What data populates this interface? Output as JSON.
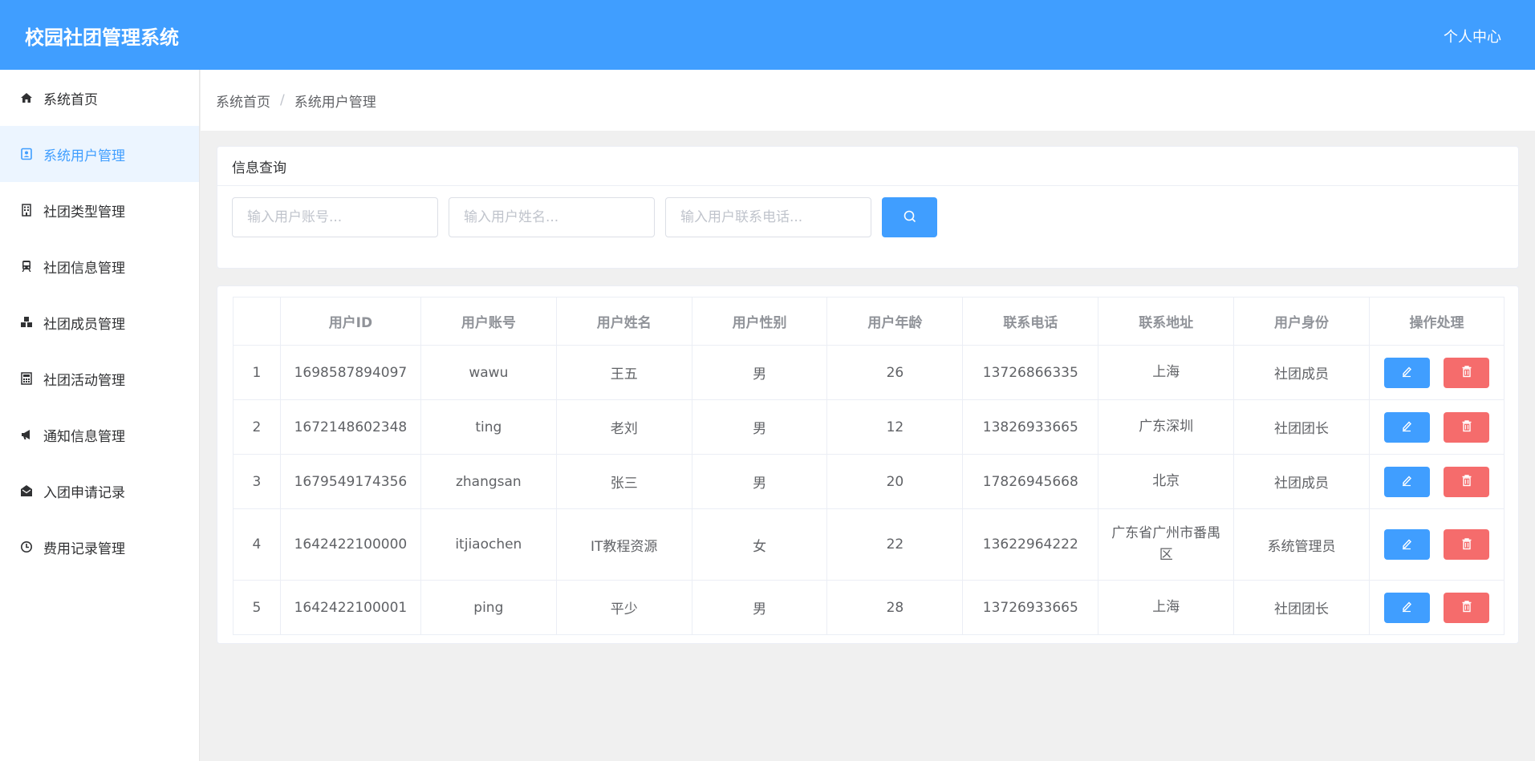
{
  "header": {
    "title": "校园社团管理系统",
    "user_center": "个人中心"
  },
  "sidebar": {
    "items": [
      {
        "label": "系统首页",
        "icon": "home-icon",
        "active": false
      },
      {
        "label": "系统用户管理",
        "icon": "user-card-icon",
        "active": true
      },
      {
        "label": "社团类型管理",
        "icon": "building-icon",
        "active": false
      },
      {
        "label": "社团信息管理",
        "icon": "train-icon",
        "active": false
      },
      {
        "label": "社团成员管理",
        "icon": "cubes-icon",
        "active": false
      },
      {
        "label": "社团活动管理",
        "icon": "calculator-icon",
        "active": false
      },
      {
        "label": "通知信息管理",
        "icon": "megaphone-icon",
        "active": false
      },
      {
        "label": "入团申请记录",
        "icon": "envelope-open-icon",
        "active": false
      },
      {
        "label": "费用记录管理",
        "icon": "clock-icon",
        "active": false
      }
    ]
  },
  "breadcrumb": {
    "home": "系统首页",
    "separator": "/",
    "current": "系统用户管理"
  },
  "query": {
    "title": "信息查询",
    "account_placeholder": "输入用户账号...",
    "name_placeholder": "输入用户姓名...",
    "phone_placeholder": "输入用户联系电话..."
  },
  "table": {
    "headers": [
      "",
      "用户ID",
      "用户账号",
      "用户姓名",
      "用户性别",
      "用户年龄",
      "联系电话",
      "联系地址",
      "用户身份",
      "操作处理"
    ],
    "rows": [
      {
        "index": "1",
        "id": "1698587894097",
        "account": "wawu",
        "name": "王五",
        "gender": "男",
        "age": "26",
        "phone": "13726866335",
        "address": "上海",
        "role": "社团成员"
      },
      {
        "index": "2",
        "id": "1672148602348",
        "account": "ting",
        "name": "老刘",
        "gender": "男",
        "age": "12",
        "phone": "13826933665",
        "address": "广东深圳",
        "role": "社团团长"
      },
      {
        "index": "3",
        "id": "1679549174356",
        "account": "zhangsan",
        "name": "张三",
        "gender": "男",
        "age": "20",
        "phone": "17826945668",
        "address": "北京",
        "role": "社团成员"
      },
      {
        "index": "4",
        "id": "1642422100000",
        "account": "itjiaochen",
        "name": "IT教程资源",
        "gender": "女",
        "age": "22",
        "phone": "13622964222",
        "address": "广东省广州市番禺区",
        "role": "系统管理员"
      },
      {
        "index": "5",
        "id": "1642422100001",
        "account": "ping",
        "name": "平少",
        "gender": "男",
        "age": "28",
        "phone": "13726933665",
        "address": "上海",
        "role": "社团团长"
      }
    ]
  },
  "colors": {
    "primary": "#409eff",
    "danger": "#f56c6c",
    "active_bg": "#ecf5ff"
  }
}
